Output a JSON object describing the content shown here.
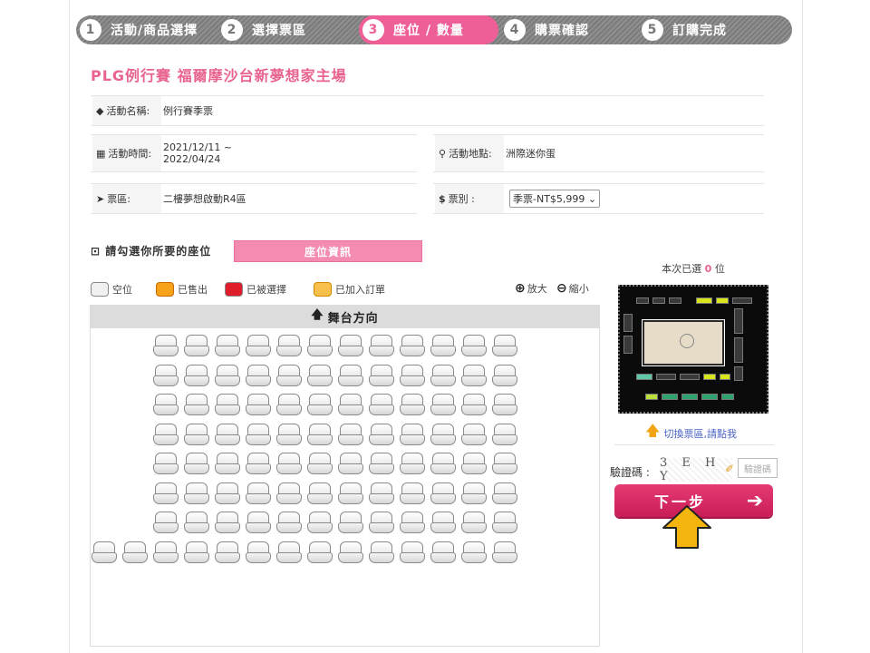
{
  "steps": [
    {
      "num": "1",
      "label": "活動/商品選擇"
    },
    {
      "num": "2",
      "label": "選擇票區"
    },
    {
      "num": "3",
      "label": "座位 / 數量"
    },
    {
      "num": "4",
      "label": "購票確認"
    },
    {
      "num": "5",
      "label": "訂購完成"
    }
  ],
  "active_step": "3",
  "event_title": "PLG例行賽 福爾摩沙台新夢想家主場",
  "info": {
    "name_label": "活動名稱:",
    "name_value": "例行賽季票",
    "time_label": "活動時間:",
    "time_value_line1": "2021/12/11 ~",
    "time_value_line2": "2022/04/24",
    "venue_label": "活動地點:",
    "venue_value": "洲際迷你蛋",
    "zone_label": "票區:",
    "zone_value": "二樓夢想啟動R4區",
    "type_label": "票別 :",
    "type_selected": "季票-NT$5,999"
  },
  "seat_section": {
    "pick_label": "請勾選你所要的座位",
    "seat_info_button": "座位資訊",
    "legend": {
      "empty": "空位",
      "sold": "已售出",
      "taken": "已被選擇",
      "added": "已加入訂單"
    },
    "zoom_in": "放大",
    "zoom_out": "縮小",
    "stage_label": "舞台方向",
    "rows": [
      12,
      12,
      12,
      12,
      12,
      12,
      12,
      14
    ]
  },
  "sidebar": {
    "selected_prefix": "本次已選",
    "selected_count": "0",
    "selected_suffix": "位",
    "switch_link": "切換票區,請點我",
    "captcha_label": "驗證碼 :",
    "captcha_text": "3 E H Y",
    "captcha_placeholder": "驗證碼",
    "next_button": "下一步"
  },
  "colors": {
    "brand_pink": "#e8638e",
    "active_step": "#ef5f97",
    "next_button": "#d8275f",
    "pointer_arrow": "#f5b50f"
  }
}
